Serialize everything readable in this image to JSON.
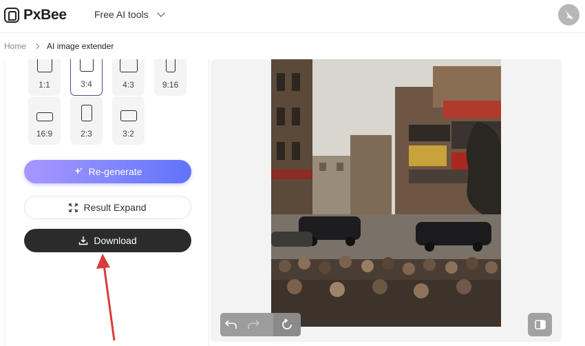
{
  "header": {
    "logo_text": "PxBee",
    "nav_tools_label": "Free AI tools"
  },
  "breadcrumb": {
    "home": "Home",
    "current": "AI image extender"
  },
  "ratios": [
    {
      "label": "1:1",
      "selected": false
    },
    {
      "label": "3:4",
      "selected": true
    },
    {
      "label": "4:3",
      "selected": false
    },
    {
      "label": "9:16",
      "selected": false
    },
    {
      "label": "16:9",
      "selected": false
    },
    {
      "label": "2:3",
      "selected": false
    },
    {
      "label": "3:2",
      "selected": false
    }
  ],
  "buttons": {
    "regenerate": "Re-generate",
    "result_expand": "Result Expand",
    "download": "Download"
  },
  "canvas_tools": {
    "undo": "undo-icon",
    "redo": "redo-icon",
    "reset": "reset-icon",
    "compare": "compare-icon"
  },
  "colors": {
    "accent_gradient_start": "#a996ff",
    "accent_gradient_end": "#5f73f8",
    "download_bg": "#2a2b2d",
    "annotation_arrow": "#d83a3a"
  }
}
